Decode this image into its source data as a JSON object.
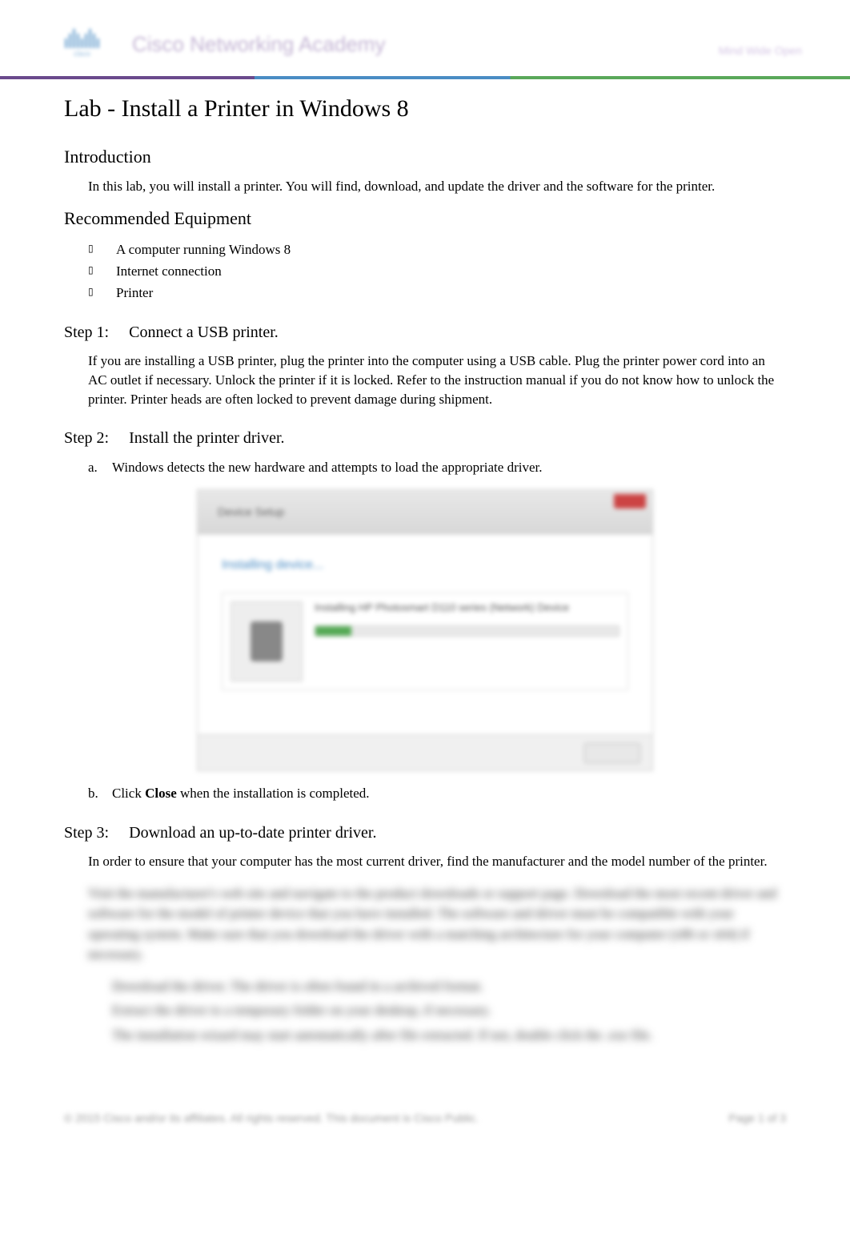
{
  "header": {
    "logo_text": "cisco",
    "academy_text": "Cisco Networking Academy",
    "tagline": "Mind Wide Open"
  },
  "title": "Lab - Install a Printer in Windows 8",
  "sections": {
    "intro": {
      "heading": "Introduction",
      "text": "In this lab, you will install a printer. You will find, download, and update the driver and the software for the printer."
    },
    "equipment": {
      "heading": "Recommended Equipment",
      "items": [
        "A computer running Windows 8",
        "Internet connection",
        "Printer"
      ]
    },
    "step1": {
      "label": "Step 1:",
      "title": "Connect a USB printer.",
      "text": "If you are installing a USB printer, plug the printer into the computer using a USB cable. Plug the printer power cord into an AC outlet if necessary. Unlock the printer if it is locked. Refer to the instruction manual if you do not know how to unlock the printer. Printer heads are often locked to prevent damage during shipment."
    },
    "step2": {
      "label": "Step 2:",
      "title": "Install the printer driver.",
      "items": [
        {
          "marker": "a.",
          "text": "Windows detects the new hardware and attempts to load the appropriate driver."
        },
        {
          "marker": "b.",
          "text_before": "Click ",
          "bold_word": "Close",
          "text_after": " when the installation is completed."
        }
      ],
      "screenshot": {
        "window_title": "Device Setup",
        "status_text": "Installing device...",
        "device_name": "Installing HP Photosmart D110 series (Network) Device"
      }
    },
    "step3": {
      "label": "Step 3:",
      "title": "Download an up-to-date printer driver.",
      "text": "In order to ensure that your computer has the most current driver, find the manufacturer and the model number of the printer.",
      "blurred_para": "Visit the manufacturer's web site and navigate to the product downloads or support page. Download the most recent driver and software for the model of printer device that you have installed. The software and driver must be compatible with your operating system. Make sure that you download the driver with a matching architecture for your computer (x86 or x64) if necessary.",
      "blurred_items": [
        "Download the driver. The driver is often found in a archived format.",
        "Extract the driver to a temporary folder on your desktop, if necessary.",
        "The installation wizard may start automatically after file extracted. If not, double click the .exe file."
      ]
    }
  },
  "footer": {
    "copyright": "© 2015 Cisco and/or its affiliates. All rights reserved. This document is Cisco Public.",
    "page": "Page 1 of 3"
  }
}
